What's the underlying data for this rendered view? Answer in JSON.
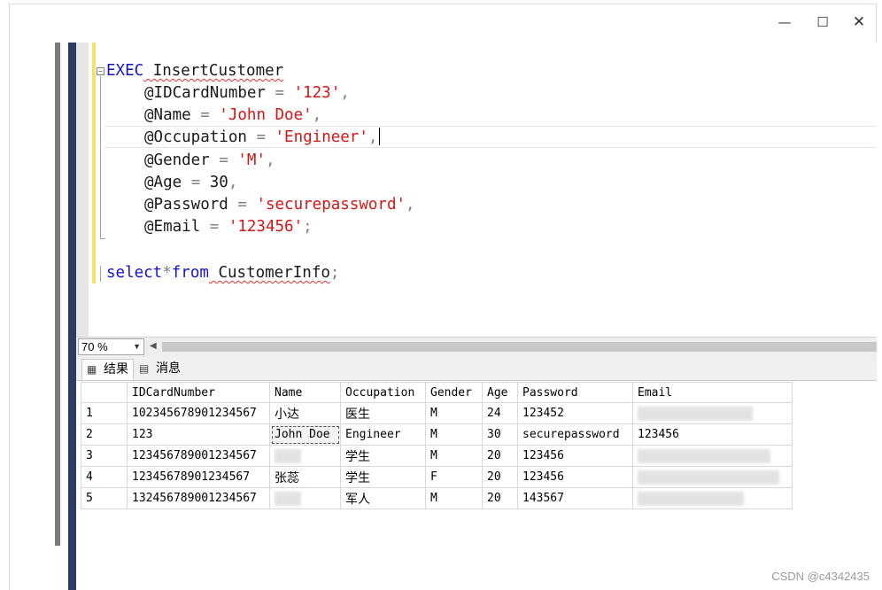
{
  "window": {
    "minimize_glyph": "—",
    "maximize_glyph": "☐",
    "close_glyph": "✕"
  },
  "editor": {
    "lines": [
      {
        "kw": "EXEC",
        "text": " InsertCustomer"
      },
      {
        "param": "@IDCardNumber",
        "eq": " = ",
        "val": "'123'",
        "sep": ","
      },
      {
        "param": "@Name",
        "eq": " = ",
        "val": "'John Doe'",
        "sep": ","
      },
      {
        "param": "@Occupation",
        "eq": " = ",
        "val": "'Engineer'",
        "sep": ","
      },
      {
        "param": "@Gender",
        "eq": " = ",
        "val": "'M'",
        "sep": ","
      },
      {
        "param": "@Age",
        "eq": " = ",
        "val": "30",
        "sep": ","
      },
      {
        "param": "@Password",
        "eq": " = ",
        "val": "'securepassword'",
        "sep": ","
      },
      {
        "param": "@Email",
        "eq": " = ",
        "val": "'123456'",
        "sep": ";"
      }
    ],
    "select_line": {
      "kw1": "select",
      "op": "*",
      "kw2": "from",
      "table": " CustomerInfo",
      "sep": ";"
    }
  },
  "zoom": {
    "value": "70 %"
  },
  "tabs": {
    "results": "结果",
    "messages": "消息"
  },
  "results": {
    "columns": [
      "IDCardNumber",
      "Name",
      "Occupation",
      "Gender",
      "Age",
      "Password",
      "Email"
    ],
    "rows": [
      {
        "n": "1",
        "id": "102345678901234567",
        "name": "小达",
        "occupation": "医生",
        "gender": "M",
        "age": "24",
        "password": "123452",
        "email": ""
      },
      {
        "n": "2",
        "id": "123",
        "name": "John Doe",
        "occupation": "Engineer",
        "gender": "M",
        "age": "30",
        "password": "securepassword",
        "email": "123456"
      },
      {
        "n": "3",
        "id": "123456789001234567",
        "name": "",
        "occupation": "学生",
        "gender": "M",
        "age": "20",
        "password": "123456",
        "email": ""
      },
      {
        "n": "4",
        "id": "12345678901234567",
        "name": "张蕊",
        "occupation": "学生",
        "gender": "F",
        "age": "20",
        "password": "123456",
        "email": ""
      },
      {
        "n": "5",
        "id": "132456789001234567",
        "name": "",
        "occupation": "军人",
        "gender": "M",
        "age": "20",
        "password": "143567",
        "email": ""
      }
    ]
  },
  "watermark": "CSDN @c4342435"
}
